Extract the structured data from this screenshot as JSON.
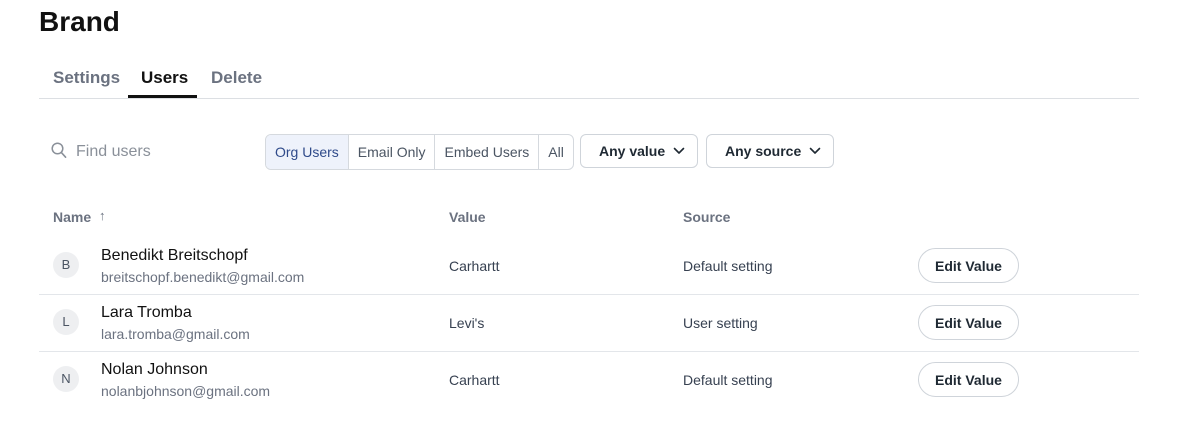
{
  "page": {
    "title": "Brand"
  },
  "tabs": {
    "settings": "Settings",
    "users": "Users",
    "delete": "Delete"
  },
  "search": {
    "placeholder": "Find users",
    "value": ""
  },
  "filters": {
    "segments": {
      "org_users": "Org Users",
      "email_only": "Email Only",
      "embed_users": "Embed Users",
      "all": "All"
    },
    "selected_segment": "Org Users",
    "value_dropdown": "Any value",
    "source_dropdown": "Any source"
  },
  "table": {
    "columns": {
      "name": "Name",
      "value": "Value",
      "source": "Source"
    },
    "sort_indicator": "↑",
    "rows": [
      {
        "initial": "B",
        "name": "Benedikt Breitschopf",
        "email": "breitschopf.benedikt@gmail.com",
        "value": "Carhartt",
        "source": "Default setting",
        "action": "Edit Value"
      },
      {
        "initial": "L",
        "name": "Lara Tromba",
        "email": "lara.tromba@gmail.com",
        "value": "Levi's",
        "source": "User setting",
        "action": "Edit Value"
      },
      {
        "initial": "N",
        "name": "Nolan Johnson",
        "email": "nolanbjohnson@gmail.com",
        "value": "Carhartt",
        "source": "Default setting",
        "action": "Edit Value"
      }
    ]
  },
  "colors": {
    "active_tab": "#111111",
    "selected_segment_bg": "#eef2fb",
    "selected_segment_text": "#2f4a8a"
  }
}
